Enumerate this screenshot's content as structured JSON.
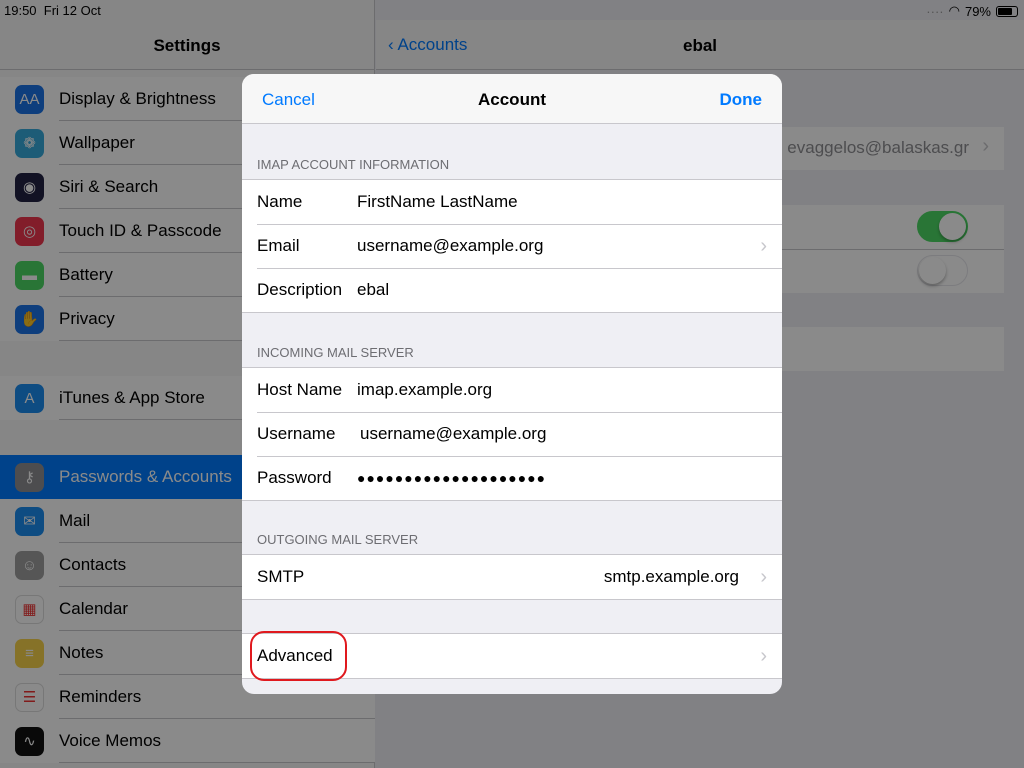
{
  "status": {
    "time": "19:50",
    "date": "Fri 12 Oct",
    "battery": "79%",
    "battery_level": 0.79
  },
  "sidebar": {
    "title": "Settings",
    "items": [
      {
        "label": "Display & Brightness",
        "icon": "display-brightness-icon",
        "color": "#1a73e8",
        "glyph": "AA"
      },
      {
        "label": "Wallpaper",
        "icon": "wallpaper-icon",
        "color": "#36aadc",
        "glyph": "❁"
      },
      {
        "label": "Siri & Search",
        "icon": "siri-icon",
        "color": "#222244",
        "glyph": "◉"
      },
      {
        "label": "Touch ID & Passcode",
        "icon": "fingerprint-icon",
        "color": "#f0364e",
        "glyph": "◎"
      },
      {
        "label": "Battery",
        "icon": "battery-icon",
        "color": "#4cd964",
        "glyph": "▬"
      },
      {
        "label": "Privacy",
        "icon": "hand-icon",
        "color": "#1a73e8",
        "glyph": "✋"
      },
      {
        "label": "iTunes & App Store",
        "icon": "app-store-icon",
        "color": "#1a8cf0",
        "glyph": "A"
      },
      {
        "label": "Passwords & Accounts",
        "icon": "key-icon",
        "color": "#8e8e93",
        "glyph": "⚷"
      },
      {
        "label": "Mail",
        "icon": "mail-icon",
        "color": "#1a8cf0",
        "glyph": "✉"
      },
      {
        "label": "Contacts",
        "icon": "contacts-icon",
        "color": "#a0a0a0",
        "glyph": "☺"
      },
      {
        "label": "Calendar",
        "icon": "calendar-icon",
        "color": "#ffffff",
        "glyph": "▦"
      },
      {
        "label": "Notes",
        "icon": "notes-icon",
        "color": "#f7d24a",
        "glyph": "≡"
      },
      {
        "label": "Reminders",
        "icon": "reminders-icon",
        "color": "#ffffff",
        "glyph": "☰"
      },
      {
        "label": "Voice Memos",
        "icon": "voice-memos-icon",
        "color": "#111111",
        "glyph": "∿"
      }
    ],
    "selected": "Passwords & Accounts"
  },
  "detail": {
    "back": "Accounts",
    "title": "ebal",
    "account_email": "evaggelos@balaskas.gr",
    "toggle1": true,
    "toggle2": false
  },
  "modal": {
    "cancel": "Cancel",
    "title": "Account",
    "done": "Done",
    "sec1": "IMAP ACCOUNT INFORMATION",
    "name_k": "Name",
    "name_v": "FirstName LastName",
    "email_k": "Email",
    "email_v": "username@example.org",
    "desc_k": "Description",
    "desc_v": "ebal",
    "sec2": "INCOMING MAIL SERVER",
    "host_k": "Host Name",
    "host_v": "imap.example.org",
    "user_k": "Username",
    "user_v": "username@example.org",
    "pass_k": "Password",
    "pass_v": "●●●●●●●●●●●●●●●●●●●●",
    "sec3": "OUTGOING MAIL SERVER",
    "smtp_k": "SMTP",
    "smtp_v": "smtp.example.org",
    "advanced": "Advanced"
  },
  "colors": {
    "accent": "#007aff",
    "highlight_ring": "#e0191e"
  }
}
